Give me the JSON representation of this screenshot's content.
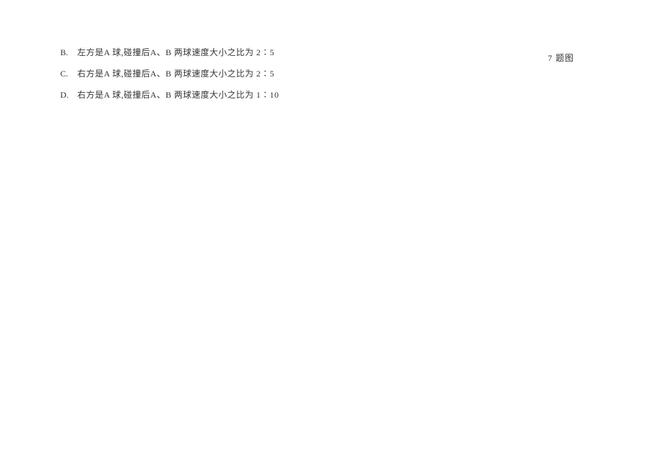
{
  "options": {
    "B": {
      "label": "B.",
      "text": "左方是A 球,碰撞后A、B 两球速度大小之比为 2∶5"
    },
    "C": {
      "label": "C.",
      "text": "右方是A 球,碰撞后A、B 两球速度大小之比为 2∶5"
    },
    "D": {
      "label": "D.",
      "text": "右方是A 球,碰撞后A、B 两球速度大小之比为 1∶10"
    }
  },
  "figure_caption": "7 题图"
}
